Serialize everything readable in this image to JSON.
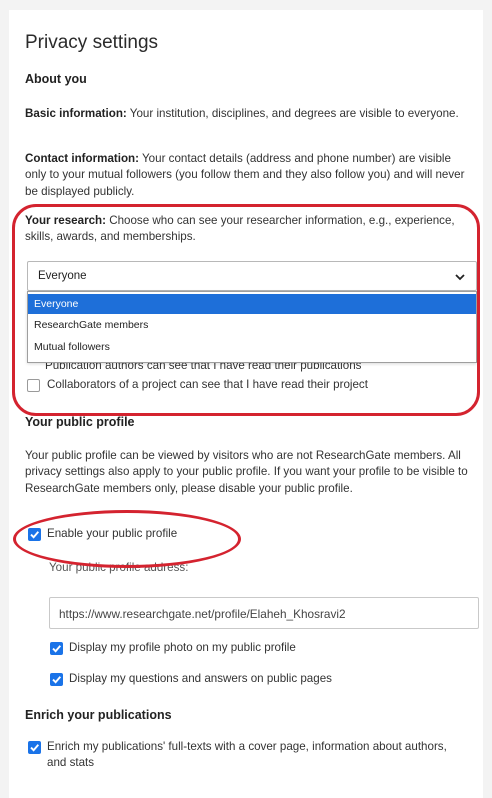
{
  "page": {
    "title": "Privacy settings"
  },
  "about_you": {
    "heading": "About you",
    "basic_label": "Basic information:",
    "basic_text": " Your institution, disciplines, and degrees are visible to everyone.",
    "contact_label": "Contact information:",
    "contact_text": " Your contact details (address and phone number) are visible only to your mutual followers (you follow them and they also follow you) and will never be displayed publicly.",
    "research_label": "Your research:",
    "research_text": " Choose who can see your researcher information, e.g., experience, skills, awards, and memberships."
  },
  "research_select": {
    "value": "Everyone",
    "options": [
      "Everyone",
      "ResearchGate members",
      "Mutual followers"
    ],
    "selected_index": 0
  },
  "read_settings": {
    "publication_authors": "Publication authors can see that I have read their publications",
    "collaborators": "Collaborators of a project can see that I have read their project"
  },
  "public_profile": {
    "heading": "Your public profile",
    "description": "Your public profile can be viewed by visitors who are not ResearchGate members. All privacy settings also apply to your public profile. If you want your profile to be visible to ResearchGate members only, please disable your public profile.",
    "enable_label": "Enable your public profile",
    "address_label": "Your public profile address:",
    "address_value": "https://www.researchgate.net/profile/Elaheh_Khosravi2",
    "photo_label": "Display my profile photo on my public profile",
    "qa_label": "Display my questions and answers on public pages"
  },
  "enrich": {
    "heading": "Enrich your publications",
    "label": "Enrich my publications' full-texts with a cover page, information about authors, and stats"
  },
  "colors": {
    "accent": "#1a73e8",
    "selected_option": "#1e6fd9",
    "annotation": "#d4232f"
  },
  "icons": {
    "select_chevron": "chevron-down-icon",
    "checkmark": "check-icon"
  }
}
